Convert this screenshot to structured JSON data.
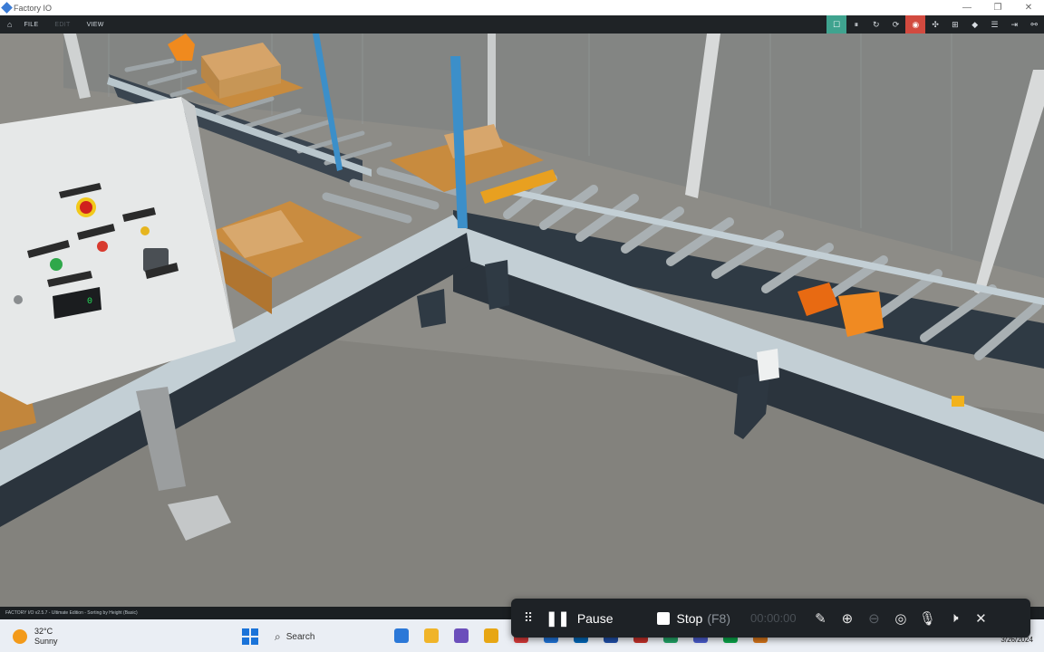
{
  "window": {
    "title": "Factory IO",
    "controls": [
      "—",
      "❐",
      "✕"
    ]
  },
  "menu": {
    "home_icon": "home-icon",
    "items": [
      {
        "label": "FILE",
        "enabled": true
      },
      {
        "label": "EDIT",
        "enabled": false
      },
      {
        "label": "VIEW",
        "enabled": true
      }
    ]
  },
  "tools": [
    {
      "icon": "select-icon",
      "glyph": "☐",
      "state": "active"
    },
    {
      "icon": "pause-icon",
      "glyph": "⏸",
      "state": "normal"
    },
    {
      "icon": "reset-icon",
      "glyph": "↻",
      "state": "normal"
    },
    {
      "icon": "restart-icon",
      "glyph": "⟳",
      "state": "normal"
    },
    {
      "icon": "camera-icon",
      "glyph": "◉",
      "state": "alert"
    },
    {
      "icon": "sensor-icon",
      "glyph": "✣",
      "state": "normal"
    },
    {
      "icon": "plc-icon",
      "glyph": "⊞",
      "state": "normal"
    },
    {
      "icon": "drivers-icon",
      "glyph": "◆",
      "state": "normal"
    },
    {
      "icon": "list-icon",
      "glyph": "☰",
      "state": "normal"
    },
    {
      "icon": "dock-icon",
      "glyph": "⇥",
      "state": "normal"
    },
    {
      "icon": "link-icon",
      "glyph": "⚯",
      "state": "normal"
    }
  ],
  "scene": {
    "panel": {
      "digital_display": "0"
    }
  },
  "status_bar": {
    "text": "FACTORY I/O v2.5.7 - Ultimate Edition - Sorting by Height (Basic)"
  },
  "recorder": {
    "pause_label": "Pause",
    "stop_label": "Stop",
    "stop_hint": "(F8)",
    "timer": "00:00:00",
    "icons": [
      "pen-icon",
      "zoom-in-icon",
      "zoom-out-icon",
      "eye-icon",
      "microphone-icon",
      "speaker-icon",
      "close-icon"
    ]
  },
  "taskbar": {
    "weather_temp": "32°C",
    "weather_desc": "Sunny",
    "search_label": "Search",
    "date": "3/26/2024",
    "app_colors": [
      "#2b78d8",
      "#f0b429",
      "#6b4fbb",
      "#e7a614",
      "#d93a3a",
      "#1e73d8",
      "#0067b8",
      "#1f4fa8",
      "#c4302b",
      "#21a366",
      "#4a5ccd",
      "#0aa64a",
      "#d6751a"
    ]
  }
}
